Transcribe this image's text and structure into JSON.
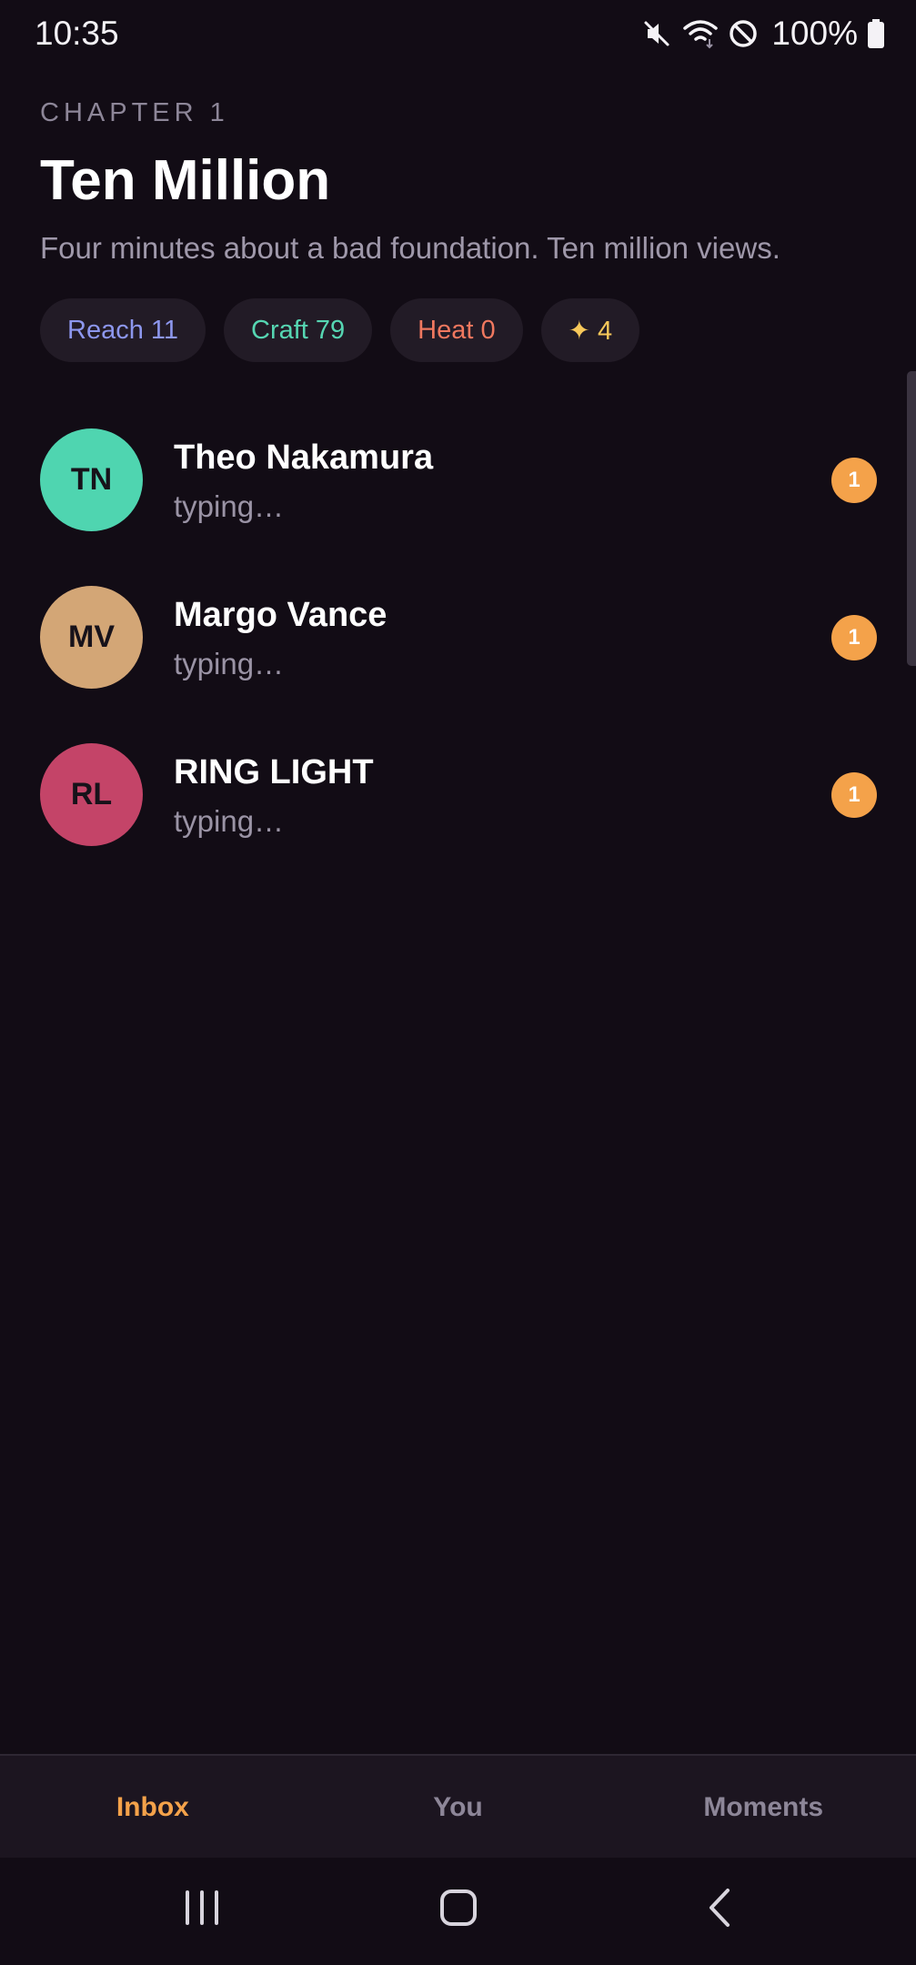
{
  "status_bar": {
    "time": "10:35",
    "battery": "100%",
    "icons": [
      "mute-icon",
      "wifi-icon",
      "do-not-disturb-icon",
      "battery-icon"
    ]
  },
  "header": {
    "chapter": "CHAPTER 1",
    "title": "Ten Million",
    "subtitle": "Four minutes about a bad foundation. Ten million views."
  },
  "stats": {
    "reach": "Reach 11",
    "craft": "Craft 79",
    "heat": "Heat 0",
    "stars": "✦ 4"
  },
  "conversations": [
    {
      "initials": "TN",
      "name": "Theo Nakamura",
      "preview": "typing…",
      "unread": "1",
      "avatar_color": "#4fd5b0"
    },
    {
      "initials": "MV",
      "name": "Margo Vance",
      "preview": "typing…",
      "unread": "1",
      "avatar_color": "#d3a676"
    },
    {
      "initials": "RL",
      "name": "RING LIGHT",
      "preview": "typing…",
      "unread": "1",
      "avatar_color": "#c44468"
    }
  ],
  "tabs": {
    "inbox": "Inbox",
    "you": "You",
    "moments": "Moments",
    "active": "inbox"
  },
  "colors": {
    "background": "#120c15",
    "accent": "#f4a24a",
    "reach": "#8d97ee",
    "craft": "#56d6b2",
    "heat": "#f0785f",
    "stars": "#f7c85a"
  }
}
